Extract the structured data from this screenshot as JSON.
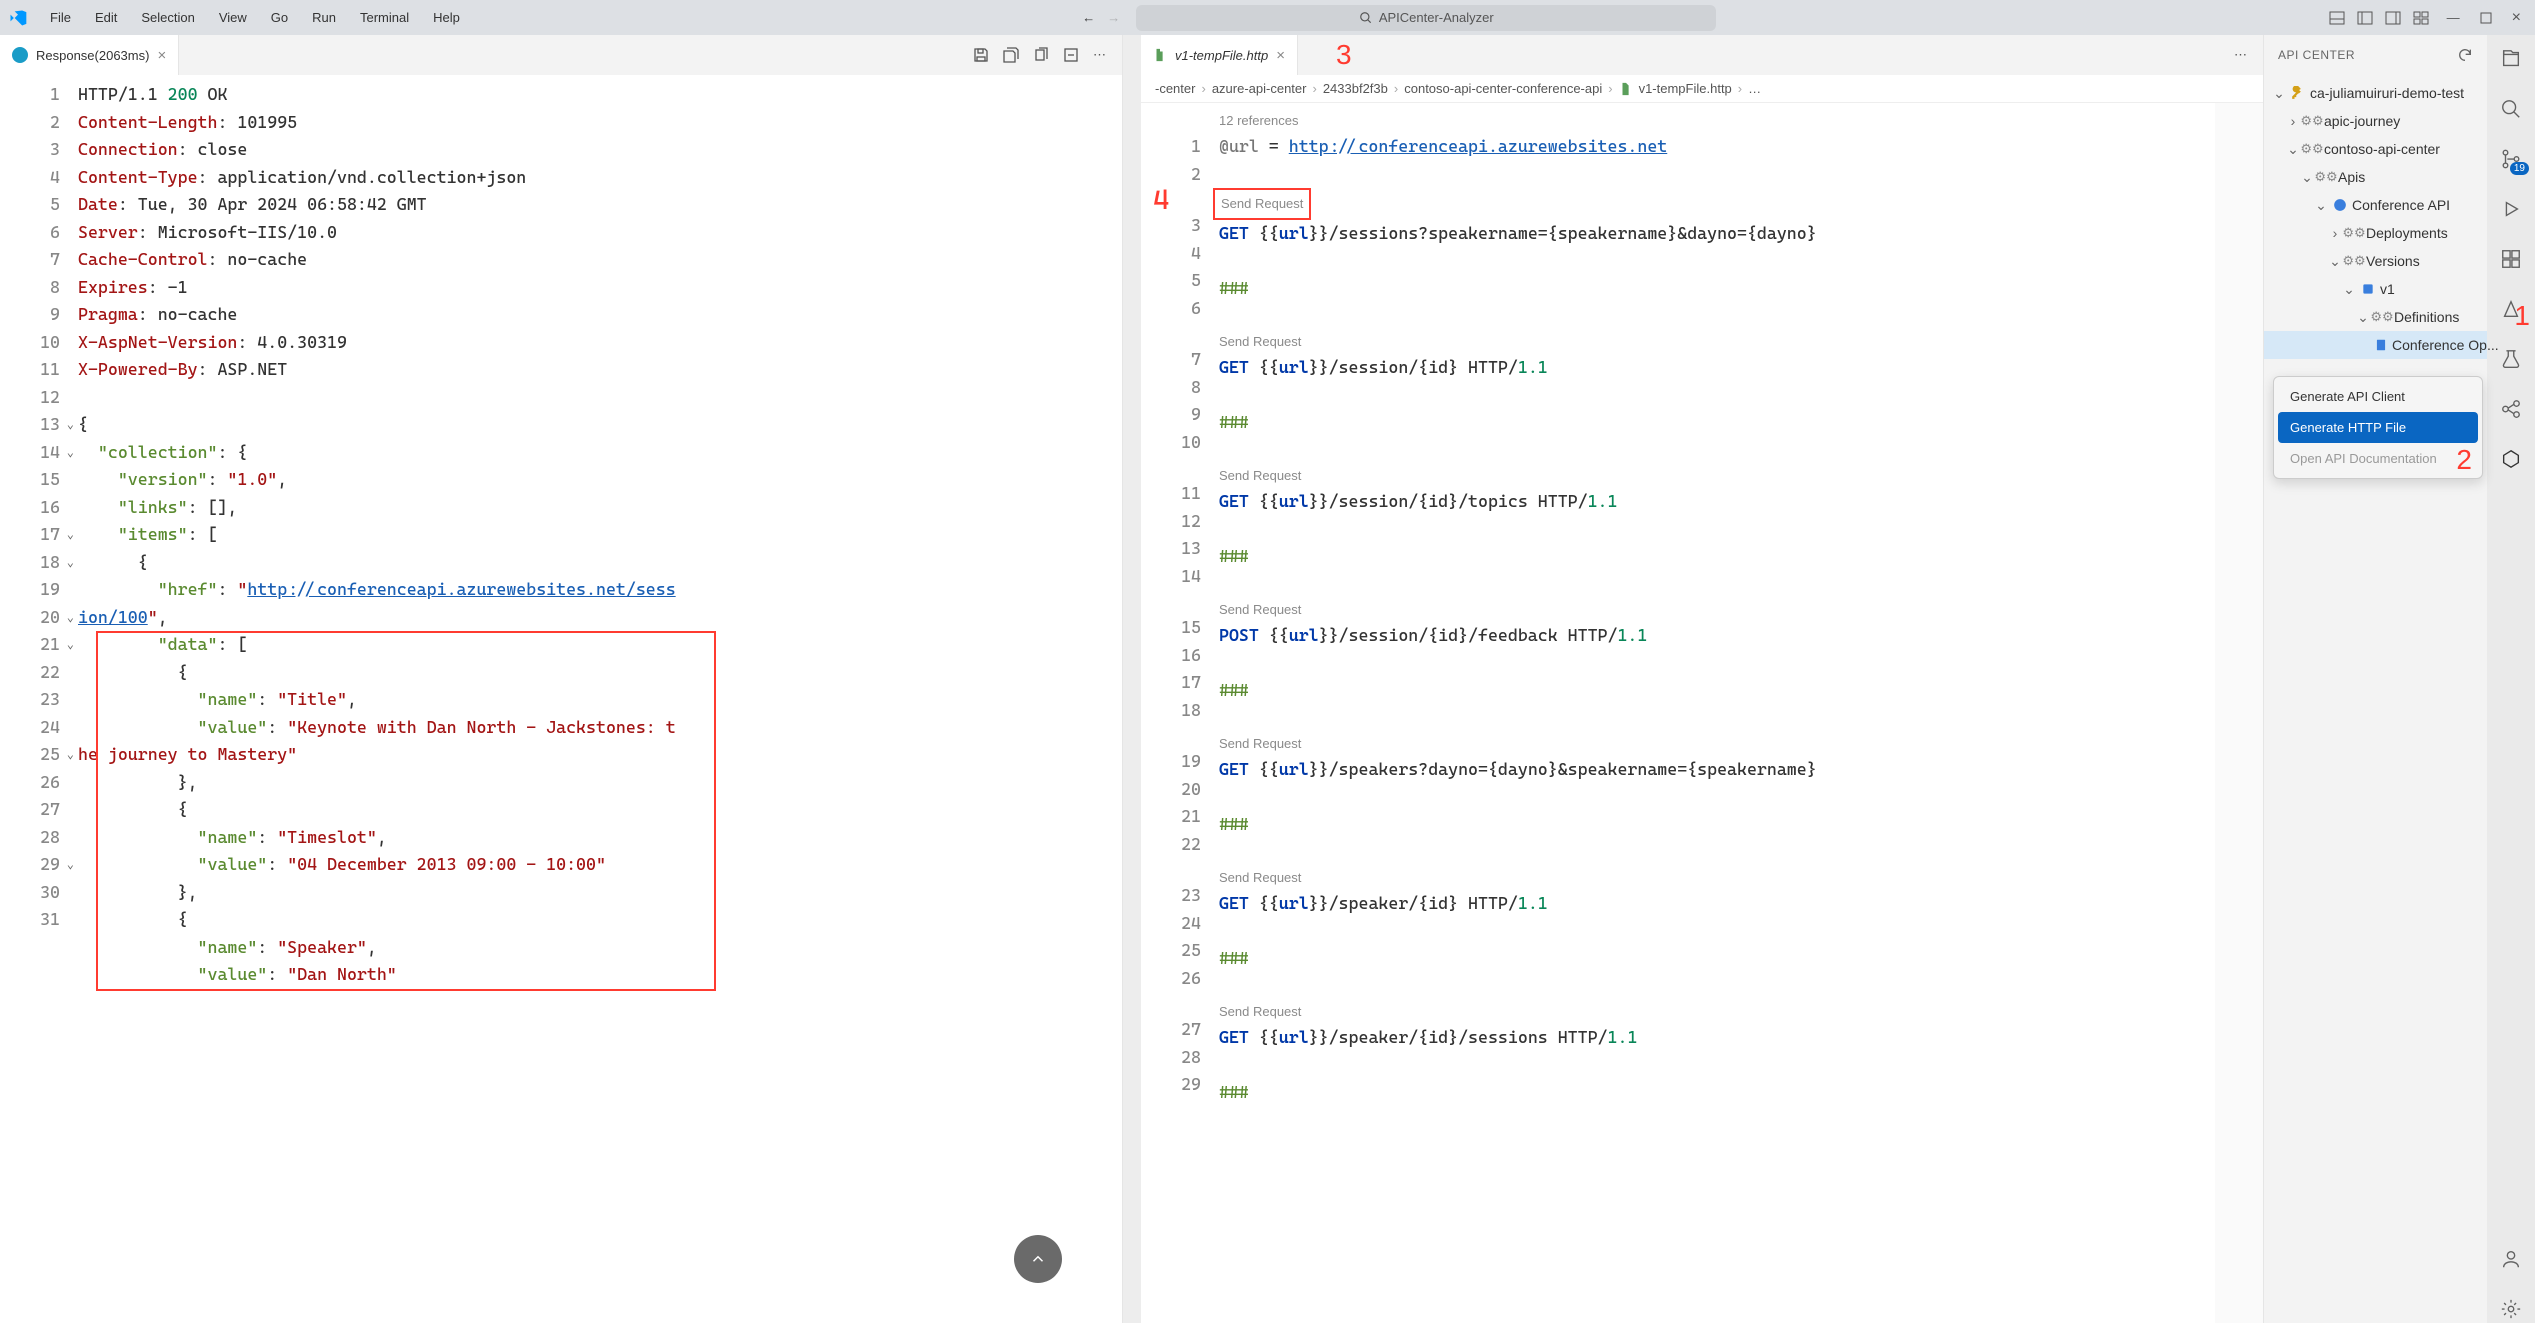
{
  "menu": [
    "File",
    "Edit",
    "Selection",
    "View",
    "Go",
    "Run",
    "Terminal",
    "Help"
  ],
  "search_placeholder": "APICenter-Analyzer",
  "tabs": {
    "left": {
      "label": "Response(2063ms)"
    },
    "right": {
      "label": "v1-tempFile.http"
    }
  },
  "breadcrumbs_right": [
    "-center",
    "azure-api-center",
    "2433bf2f3b",
    "contoso-api-center-conference-api",
    "v1-tempFile.http"
  ],
  "response_headers": [
    {
      "n": "HTTP/1.1",
      "v": "200",
      "ok": "OK"
    },
    {
      "n": "Content-Length",
      "v": "101995"
    },
    {
      "n": "Connection",
      "v": "close"
    },
    {
      "n": "Content-Type",
      "v": "application/vnd.collection+json"
    },
    {
      "n": "Date",
      "v": "Tue, 30 Apr 2024 06:58:42 GMT"
    },
    {
      "n": "Server",
      "v": "Microsoft-IIS/10.0"
    },
    {
      "n": "Cache-Control",
      "v": "no-cache"
    },
    {
      "n": "Expires",
      "v": "-1"
    },
    {
      "n": "Pragma",
      "v": "no-cache"
    },
    {
      "n": "X-AspNet-Version",
      "v": "4.0.30319"
    },
    {
      "n": "X-Powered-By",
      "v": "ASP.NET"
    }
  ],
  "response_json": {
    "collection_version": "1.0",
    "href": "http://conferenceapi.azurewebsites.net/session/100",
    "data": [
      {
        "name": "Title",
        "value": "Keynote with Dan North - Jackstones: the journey to Mastery"
      },
      {
        "name": "Timeslot",
        "value": "04 December 2013 09:00 - 10:00"
      },
      {
        "name": "Speaker",
        "value": "Dan North"
      }
    ]
  },
  "http_file": {
    "url_decl": "@url = ",
    "url_val": "http://conferenceapi.azurewebsites.net",
    "refs": "12 references",
    "send": "Send Request",
    "sep": "###",
    "requests": [
      "GET {{url}}/sessions?speakername={speakername}&dayno={dayno}",
      "GET {{url}}/session/{id} HTTP/1.1",
      "GET {{url}}/session/{id}/topics HTTP/1.1",
      "POST {{url}}/session/{id}/feedback HTTP/1.1",
      "GET {{url}}/speakers?dayno={dayno}&speakername={speakername}",
      "GET {{url}}/speaker/{id} HTTP/1.1",
      "GET {{url}}/speaker/{id}/sessions HTTP/1.1"
    ]
  },
  "sidebar": {
    "title": "API CENTER",
    "tree": [
      {
        "l": 0,
        "tw": "v",
        "ic": "key",
        "label": "ca-juliamuiruri-demo-test"
      },
      {
        "l": 1,
        "tw": ">",
        "ic": "gear2",
        "label": "apic-journey"
      },
      {
        "l": 1,
        "tw": "v",
        "ic": "gear2",
        "label": "contoso-api-center"
      },
      {
        "l": 2,
        "tw": "v",
        "ic": "scope",
        "label": "Apis"
      },
      {
        "l": 3,
        "tw": "v",
        "ic": "api",
        "label": "Conference API"
      },
      {
        "l": 4,
        "tw": ">",
        "ic": "scope",
        "label": "Deployments"
      },
      {
        "l": 4,
        "tw": "v",
        "ic": "scope",
        "label": "Versions"
      },
      {
        "l": 5,
        "tw": "v",
        "ic": "ver",
        "label": "v1"
      },
      {
        "l": 6,
        "tw": "v",
        "ic": "scope",
        "label": "Definitions"
      },
      {
        "l": 7,
        "tw": "",
        "ic": "def",
        "label": "Conference Op...",
        "sel": true
      }
    ]
  },
  "context_menu": [
    {
      "label": "Generate API Client"
    },
    {
      "label": "Generate HTTP File",
      "sel": true
    },
    {
      "label": "Open API Documentation",
      "disabled": true
    }
  ],
  "annotations": {
    "a1": "1",
    "a2": "2",
    "a3": "3",
    "a4": "4"
  },
  "activity_badge": "19"
}
